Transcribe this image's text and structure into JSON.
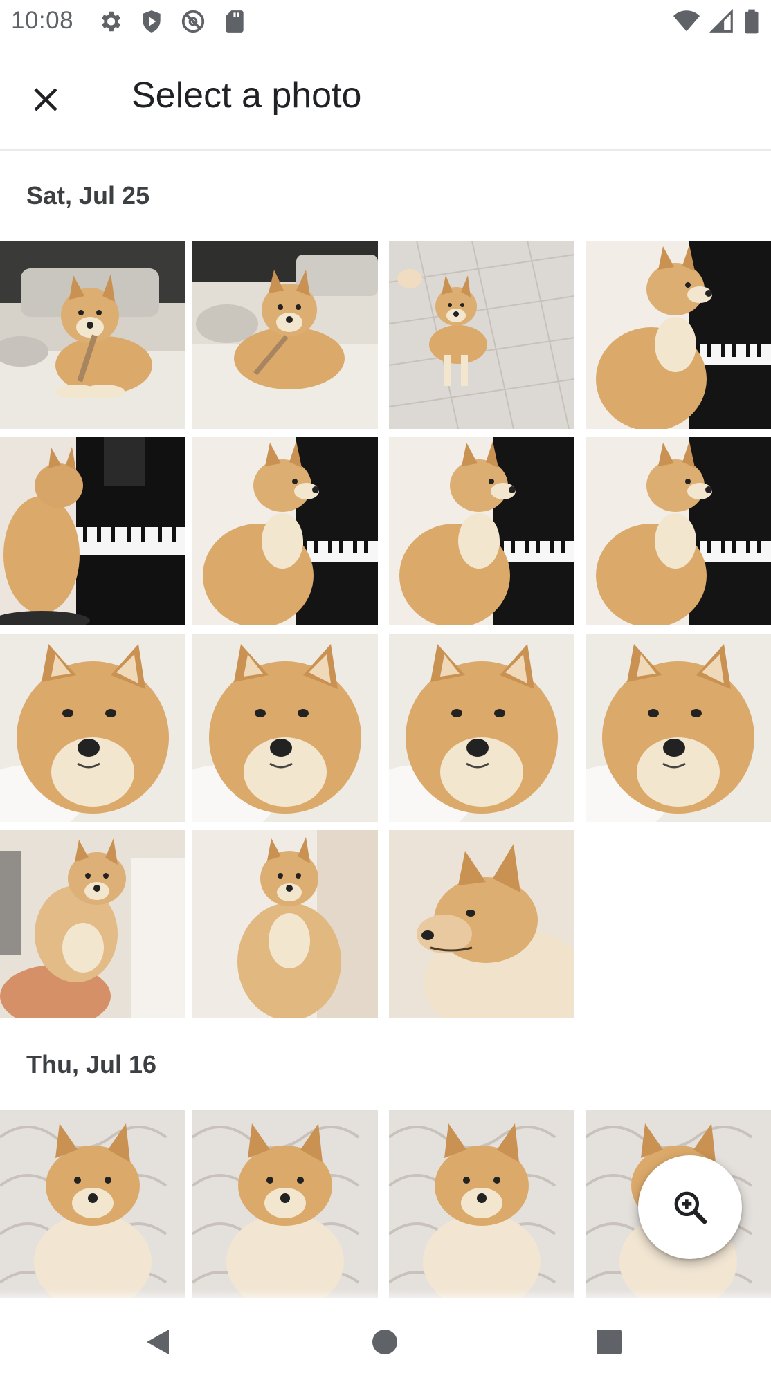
{
  "status_bar": {
    "time": "10:08",
    "left_icons": [
      "settings-icon",
      "shield-play-icon",
      "blocked-at-icon",
      "sd-card-icon"
    ],
    "right_icons": [
      "wifi-icon",
      "cell-signal-icon",
      "battery-icon"
    ]
  },
  "app_bar": {
    "title": "Select a photo",
    "close_icon": "close-icon"
  },
  "sections": [
    {
      "date": "Sat, Jul 25",
      "photo_count": 15
    },
    {
      "date": "Thu, Jul 16",
      "photo_count": 4
    }
  ],
  "fab": {
    "icon": "zoom-in-icon"
  },
  "nav_bar": {
    "icons": [
      "back-icon",
      "home-icon",
      "recents-icon"
    ]
  },
  "colors": {
    "fur": "#d9a86b",
    "fur_light": "#f3e6cf",
    "piano": "#111111",
    "floor": "#e9e4dc"
  }
}
